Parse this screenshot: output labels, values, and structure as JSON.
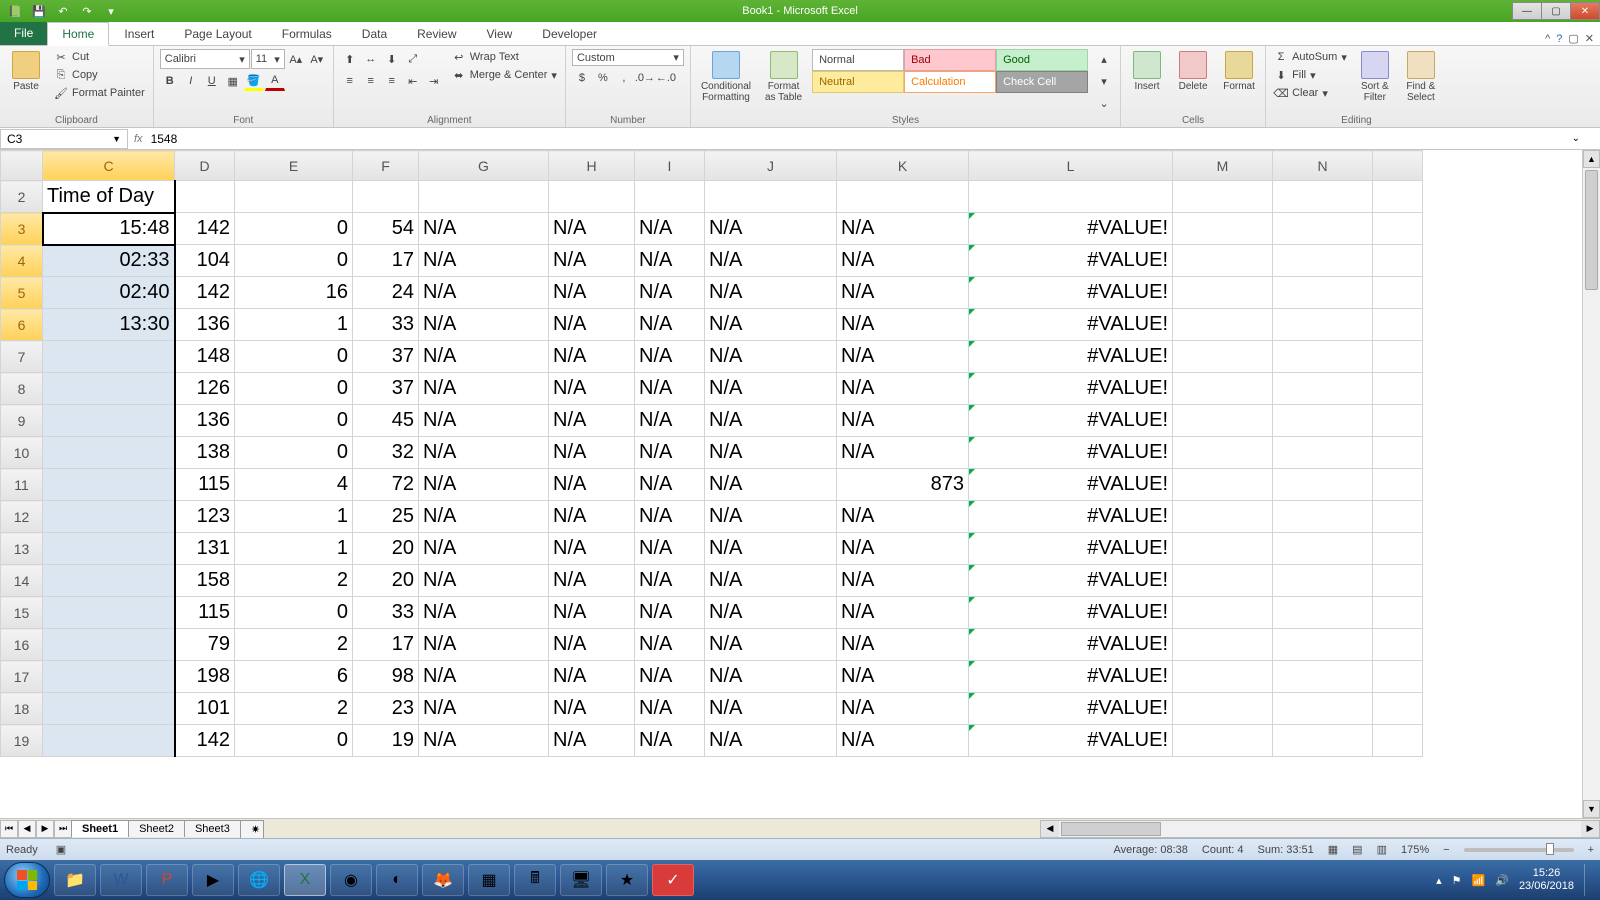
{
  "title": "Book1 - Microsoft Excel",
  "tabs": {
    "file": "File",
    "home": "Home",
    "insert": "Insert",
    "page": "Page Layout",
    "formulas": "Formulas",
    "data": "Data",
    "review": "Review",
    "view": "View",
    "dev": "Developer"
  },
  "ribbon": {
    "clipboard": {
      "paste": "Paste",
      "cut": "Cut",
      "copy": "Copy",
      "fmt": "Format Painter",
      "label": "Clipboard"
    },
    "font": {
      "name": "Calibri",
      "size": "11",
      "label": "Font"
    },
    "align": {
      "wrap": "Wrap Text",
      "merge": "Merge & Center",
      "label": "Alignment"
    },
    "number": {
      "fmt": "Custom",
      "label": "Number"
    },
    "styles": {
      "cond": "Conditional\nFormatting",
      "fat": "Format\nas Table",
      "normal": "Normal",
      "bad": "Bad",
      "good": "Good",
      "neutral": "Neutral",
      "calc": "Calculation",
      "check": "Check Cell",
      "label": "Styles"
    },
    "cells": {
      "insert": "Insert",
      "delete": "Delete",
      "format": "Format",
      "label": "Cells"
    },
    "editing": {
      "sum": "AutoSum",
      "fill": "Fill",
      "clear": "Clear",
      "sort": "Sort &\nFilter",
      "find": "Find &\nSelect",
      "label": "Editing"
    }
  },
  "namebox": "C3",
  "formula": "1548",
  "columns": [
    "C",
    "D",
    "E",
    "F",
    "G",
    "H",
    "I",
    "J",
    "K",
    "L",
    "M",
    "N",
    ""
  ],
  "header_row": "2",
  "header_cell": "Time of Day",
  "rows": [
    {
      "r": "3",
      "C": "15:48",
      "D": "142",
      "E": "0",
      "F": "54",
      "G": "N/A",
      "H": "N/A",
      "I": "N/A",
      "J": "N/A",
      "K": "N/A",
      "L": "#VALUE!"
    },
    {
      "r": "4",
      "C": "02:33",
      "D": "104",
      "E": "0",
      "F": "17",
      "G": "N/A",
      "H": "N/A",
      "I": "N/A",
      "J": "N/A",
      "K": "N/A",
      "L": "#VALUE!"
    },
    {
      "r": "5",
      "C": "02:40",
      "D": "142",
      "E": "16",
      "F": "24",
      "G": "N/A",
      "H": "N/A",
      "I": "N/A",
      "J": "N/A",
      "K": "N/A",
      "L": "#VALUE!"
    },
    {
      "r": "6",
      "C": "13:30",
      "D": "136",
      "E": "1",
      "F": "33",
      "G": "N/A",
      "H": "N/A",
      "I": "N/A",
      "J": "N/A",
      "K": "N/A",
      "L": "#VALUE!"
    },
    {
      "r": "7",
      "C": "",
      "D": "148",
      "E": "0",
      "F": "37",
      "G": "N/A",
      "H": "N/A",
      "I": "N/A",
      "J": "N/A",
      "K": "N/A",
      "L": "#VALUE!"
    },
    {
      "r": "8",
      "C": "",
      "D": "126",
      "E": "0",
      "F": "37",
      "G": "N/A",
      "H": "N/A",
      "I": "N/A",
      "J": "N/A",
      "K": "N/A",
      "L": "#VALUE!"
    },
    {
      "r": "9",
      "C": "",
      "D": "136",
      "E": "0",
      "F": "45",
      "G": "N/A",
      "H": "N/A",
      "I": "N/A",
      "J": "N/A",
      "K": "N/A",
      "L": "#VALUE!"
    },
    {
      "r": "10",
      "C": "",
      "D": "138",
      "E": "0",
      "F": "32",
      "G": "N/A",
      "H": "N/A",
      "I": "N/A",
      "J": "N/A",
      "K": "N/A",
      "L": "#VALUE!"
    },
    {
      "r": "11",
      "C": "",
      "D": "115",
      "E": "4",
      "F": "72",
      "G": "N/A",
      "H": "N/A",
      "I": "N/A",
      "J": "N/A",
      "K": "873",
      "L": "#VALUE!",
      "Kright": true
    },
    {
      "r": "12",
      "C": "",
      "D": "123",
      "E": "1",
      "F": "25",
      "G": "N/A",
      "H": "N/A",
      "I": "N/A",
      "J": "N/A",
      "K": "N/A",
      "L": "#VALUE!"
    },
    {
      "r": "13",
      "C": "",
      "D": "131",
      "E": "1",
      "F": "20",
      "G": "N/A",
      "H": "N/A",
      "I": "N/A",
      "J": "N/A",
      "K": "N/A",
      "L": "#VALUE!"
    },
    {
      "r": "14",
      "C": "",
      "D": "158",
      "E": "2",
      "F": "20",
      "G": "N/A",
      "H": "N/A",
      "I": "N/A",
      "J": "N/A",
      "K": "N/A",
      "L": "#VALUE!"
    },
    {
      "r": "15",
      "C": "",
      "D": "115",
      "E": "0",
      "F": "33",
      "G": "N/A",
      "H": "N/A",
      "I": "N/A",
      "J": "N/A",
      "K": "N/A",
      "L": "#VALUE!"
    },
    {
      "r": "16",
      "C": "",
      "D": "79",
      "E": "2",
      "F": "17",
      "G": "N/A",
      "H": "N/A",
      "I": "N/A",
      "J": "N/A",
      "K": "N/A",
      "L": "#VALUE!"
    },
    {
      "r": "17",
      "C": "",
      "D": "198",
      "E": "6",
      "F": "98",
      "G": "N/A",
      "H": "N/A",
      "I": "N/A",
      "J": "N/A",
      "K": "N/A",
      "L": "#VALUE!"
    },
    {
      "r": "18",
      "C": "",
      "D": "101",
      "E": "2",
      "F": "23",
      "G": "N/A",
      "H": "N/A",
      "I": "N/A",
      "J": "N/A",
      "K": "N/A",
      "L": "#VALUE!"
    },
    {
      "r": "19",
      "C": "",
      "D": "142",
      "E": "0",
      "F": "19",
      "G": "N/A",
      "H": "N/A",
      "I": "N/A",
      "J": "N/A",
      "K": "N/A",
      "L": "#VALUE!"
    }
  ],
  "sheets": [
    "Sheet1",
    "Sheet2",
    "Sheet3"
  ],
  "status": {
    "ready": "Ready",
    "avg": "Average: 08:38",
    "count": "Count: 4",
    "sum": "Sum: 33:51",
    "zoom": "175%"
  },
  "clock": {
    "time": "15:26",
    "date": "23/06/2018"
  }
}
